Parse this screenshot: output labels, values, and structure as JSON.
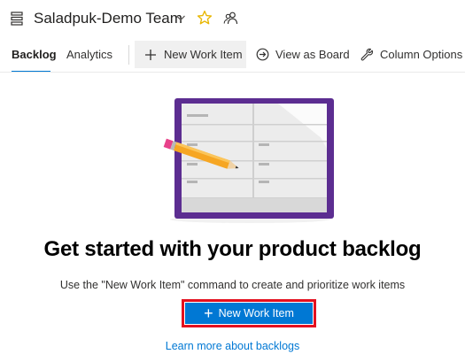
{
  "header": {
    "team_name": "Saladpuk-Demo Team",
    "icons": [
      "backlog-icon",
      "chevron-down-icon",
      "star-icon",
      "team-members-icon"
    ],
    "star_color": "#e8b600"
  },
  "tabs": [
    {
      "label": "Backlog",
      "active": true
    },
    {
      "label": "Analytics",
      "active": false
    }
  ],
  "toolbar": {
    "new_work_item_label": "New Work Item",
    "view_as_board_label": "View as Board",
    "column_options_label": "Column Options"
  },
  "empty_state": {
    "title": "Get started with your product backlog",
    "description": "Use the \"New Work Item\" command to create and prioritize work items",
    "button_label": "New Work Item",
    "link_label": "Learn more about backlogs"
  },
  "colors": {
    "accent": "#0078d4",
    "highlight_outline": "#e3101f",
    "board_frame": "#5c2d91"
  }
}
